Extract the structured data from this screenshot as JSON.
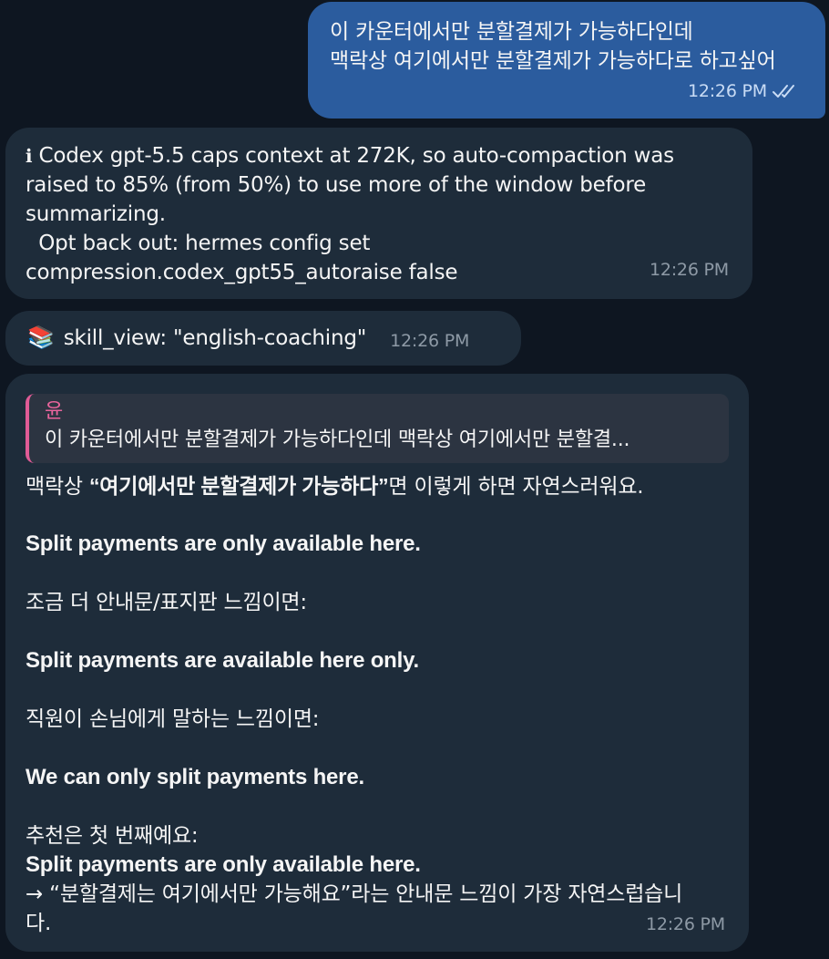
{
  "messages": {
    "outgoing": {
      "line1": "이 카운터에서만 분할결제가 가능하다인데",
      "line2": "맥락상 여기에서만 분할결제가 가능하다로 하고싶어",
      "time": "12:26 PM",
      "status_icon": "double-check-icon"
    },
    "notice": {
      "icon": "info-icon",
      "info_glyph": "ℹ",
      "line1": " Codex gpt-5.5 caps context at 272K, so auto-compaction was",
      "line2": "raised to 85% (from 50%) to use more of the window before",
      "line3": "summarizing.",
      "line4": "  Opt back out: hermes config set",
      "line5": "compression.codex_gpt55_autoraise false",
      "time": "12:26 PM"
    },
    "skill": {
      "icon": "books-icon",
      "books_glyph": "📚",
      "text": "skill_view: \"english-coaching\"",
      "time": "12:26 PM"
    },
    "reply": {
      "quote_author": "윤",
      "quote_text": "이 카운터에서만 분할결제가 가능하다인데  맥락상 여기에서만 분할결...",
      "intro_prefix": "맥락상 ",
      "intro_bold": "“여기에서만 분할결제가 가능하다”",
      "intro_suffix": "면 이렇게 하면 자연스러워요.",
      "option1": "Split payments are only available here.",
      "sign_label": "조금 더 안내문/표지판 느낌이면:",
      "option2": "Split payments are available here only.",
      "staff_label": "직원이 손님에게 말하는 느낌이면:",
      "option3": "We can only split payments here.",
      "recommend_label": "추천은 첫 번째예요:",
      "recommend_bold": "Split payments are only available here.",
      "note_line1": "→ “분할결제는 여기에서만 가능해요”라는 안내문 느낌이 가장 자연스럽습니",
      "note_line2": "다.",
      "time": "12:26 PM"
    }
  }
}
